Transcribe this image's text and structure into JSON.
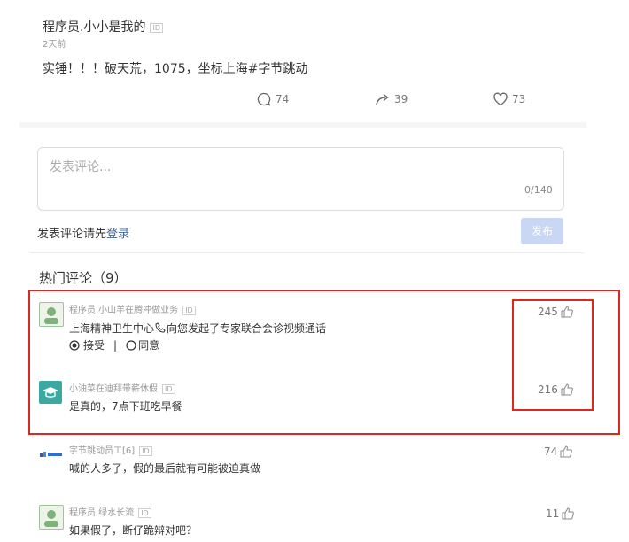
{
  "post": {
    "author": "程序员.小小是我的",
    "author_tag": "ID",
    "time": "2天前",
    "content": "实锤！！！破天荒，1075，坐标上海#字节跳动",
    "comments_count": "74",
    "shares_count": "39",
    "likes_count": "73"
  },
  "comment_box": {
    "placeholder": "发表评论...",
    "counter": "0/140",
    "login_prompt": "发表评论请先",
    "login_link": "登录",
    "publish": "发布"
  },
  "hot": {
    "title": "热门评论",
    "count": "（9）"
  },
  "comments": [
    {
      "name": "程序员.小山羊在腾冲做业务",
      "tag": "ID",
      "text": "上海精神卫生中心",
      "text_suffix": "向您发起了专家联合会诊视频通话",
      "option_accept": "接受",
      "option_divider": "|",
      "option_agree": "同意",
      "likes": "245"
    },
    {
      "name": "小油菜在迪拜带薪休假",
      "tag": "ID",
      "text": "是真的，7点下班吃早餐",
      "likes": "216"
    },
    {
      "name": "字节跳动员工[6]",
      "tag": "ID",
      "text": "喊的人多了，假的最后就有可能被迫真做",
      "likes": "74"
    },
    {
      "name": "程序员.绿水长流",
      "tag": "ID",
      "text": "如果假了，断仔跪辩对吧？",
      "likes": "11"
    }
  ],
  "colors": {
    "highlight_border": "#d9281f",
    "link": "#406599",
    "publish_button": "#c9d6f4"
  }
}
